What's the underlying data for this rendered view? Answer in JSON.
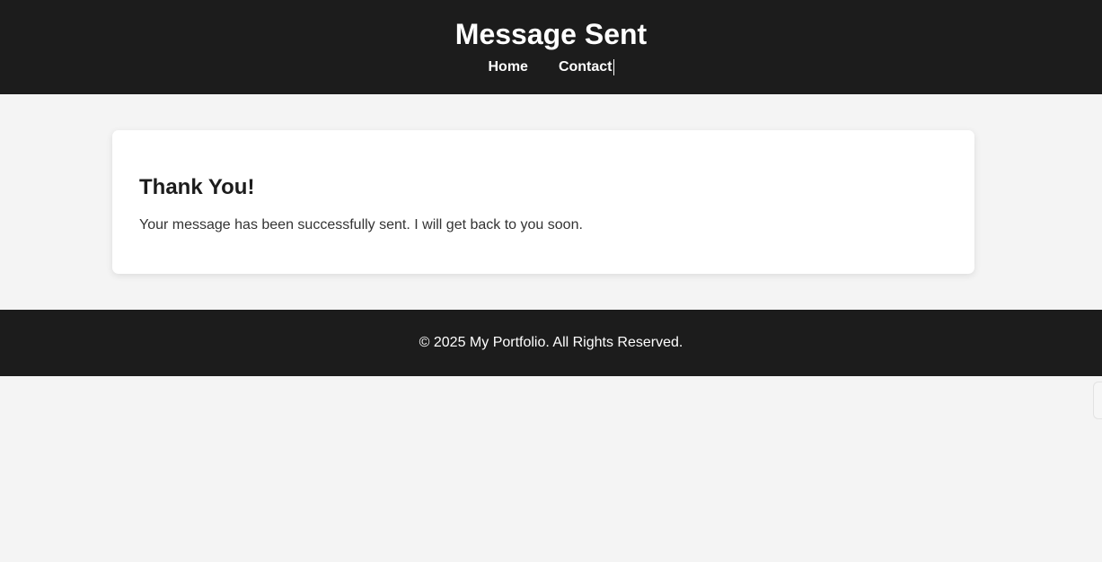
{
  "header": {
    "title": "Message Sent",
    "nav": [
      {
        "label": "Home"
      },
      {
        "label": "Contact"
      }
    ]
  },
  "main": {
    "card": {
      "title": "Thank You!",
      "message": "Your message has been successfully sent. I will get back to you soon."
    }
  },
  "footer": {
    "text": "© 2025 My Portfolio. All Rights Reserved."
  },
  "colors": {
    "header_bg": "#1c1c1c",
    "page_bg": "#f4f4f4",
    "card_bg": "#ffffff",
    "text_light": "#ffffff",
    "text_dark": "#1c1c1c"
  }
}
